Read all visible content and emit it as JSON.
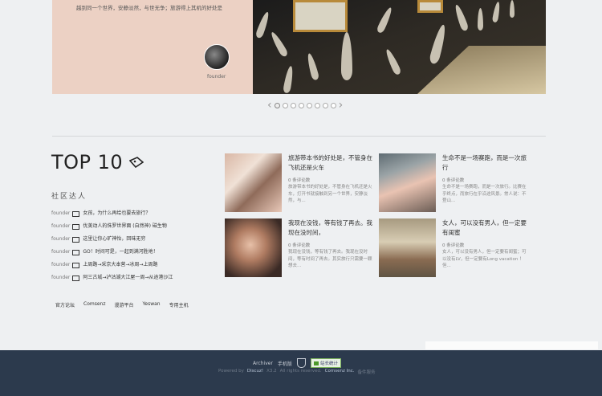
{
  "hero": {
    "text": "越到同一个世界，安静淡然，与世无争；旅游得上其机的好处是",
    "founder_label": "founder"
  },
  "slider": {
    "prev_icon": "chevron-left-icon",
    "next_icon": "chevron-right-icon",
    "dot_count": 8,
    "active_index": 0
  },
  "top10": {
    "title": "TOP 10",
    "icon": "tag-icon"
  },
  "community": {
    "heading": "社区达人",
    "items": [
      {
        "user": "founder",
        "text": "女孩，为什么再给也要去旅行？"
      },
      {
        "user": "founder",
        "text": "优美动人的侏罗世界面 (自然神) 磁生物"
      },
      {
        "user": "founder",
        "text": "这里让你心旷神怡，回味无穷"
      },
      {
        "user": "founder",
        "text": "GO！时间可是，一起到满河胜地！"
      },
      {
        "user": "founder",
        "text": "上周路→采京大本营→冰周→上周路"
      },
      {
        "user": "founder",
        "text": "阿三古城→泸沽湖大江屋一周→从途港沙江"
      }
    ]
  },
  "footer_links": [
    "官方论坛",
    "Comsenz",
    "漫游平台",
    "Yeswan",
    "专用主机"
  ],
  "cards": [
    {
      "title": "旅游带本书的好处是，不管身在飞机还是火车",
      "meta": "0 条评论数",
      "desc": "旅游带本书的好处是，不管身在飞机还是火车，打开书就接触到另一个世界，安静淡然，与..."
    },
    {
      "title": "生命不是一场赛跑，而是一次旅行",
      "meta": "0 条评论数",
      "desc": "生命不是一场赛跑，而是一次旅行。比赛在乎终点，而旅行在乎沿途风景。常人说：不登山..."
    },
    {
      "title": "我现在没钱，等有钱了再去。我现在没时间，",
      "meta": "0 条评论数",
      "desc": "我现在没钱，等有钱了再去。我现在没时间，等有时间了再去。其实旅行只需要一颗想去..."
    },
    {
      "title": "女人，可以没有男人，但一定要有闺蜜",
      "meta": "0 条评论数",
      "desc": "女人，可以没有男人，但一定要有闺蜜；可以没有LV，但一定要有Long vacation ！但..."
    }
  ],
  "site_footer": {
    "links": [
      "Archiver",
      "手机版"
    ],
    "badge": "站长统计",
    "powered_by": "Powered by",
    "discuz": "Discuz!",
    "version": "X3.2",
    "rights": "All rights reserved.",
    "company": "Comsenz Inc.",
    "suffix": "备件服务"
  }
}
